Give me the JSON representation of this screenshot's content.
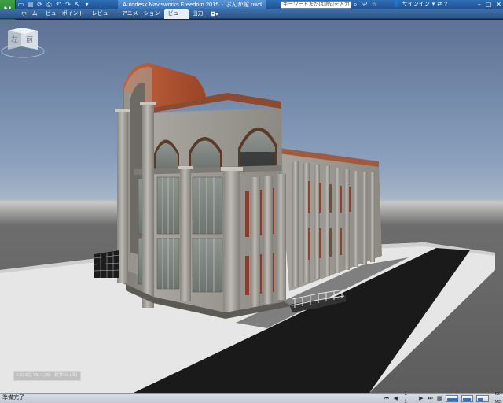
{
  "titlebar": {
    "app_logo": "N",
    "app_name": "Autodesk Navisworks Freedom 2015",
    "file_name": "ぶんか館.nwd",
    "title_separator": "-",
    "search_placeholder": "キーワードまたは語句を入力",
    "signin_label": "サインイン"
  },
  "ribbon": {
    "tabs": [
      {
        "label": "ホーム"
      },
      {
        "label": "ビューポイント"
      },
      {
        "label": "レビュー"
      },
      {
        "label": "アニメーション"
      },
      {
        "label": "ビュー"
      },
      {
        "label": "出力"
      }
    ],
    "active_tab": "ビュー"
  },
  "viewcube": {
    "face_left": "左",
    "face_front": "前"
  },
  "viewport": {
    "coord_readout": "X:1(-30)-Y5(-1.38) : 建井GL (床)"
  },
  "statusbar": {
    "status": "準備完了",
    "page": "1 / 1",
    "memory": "634 MB"
  },
  "colors": {
    "titlebar": "#2f6fb5",
    "ribbon": "#3d6fa8",
    "app_logo": "#3fa046",
    "roof": "#b5522f",
    "facade": "#9a9790"
  }
}
